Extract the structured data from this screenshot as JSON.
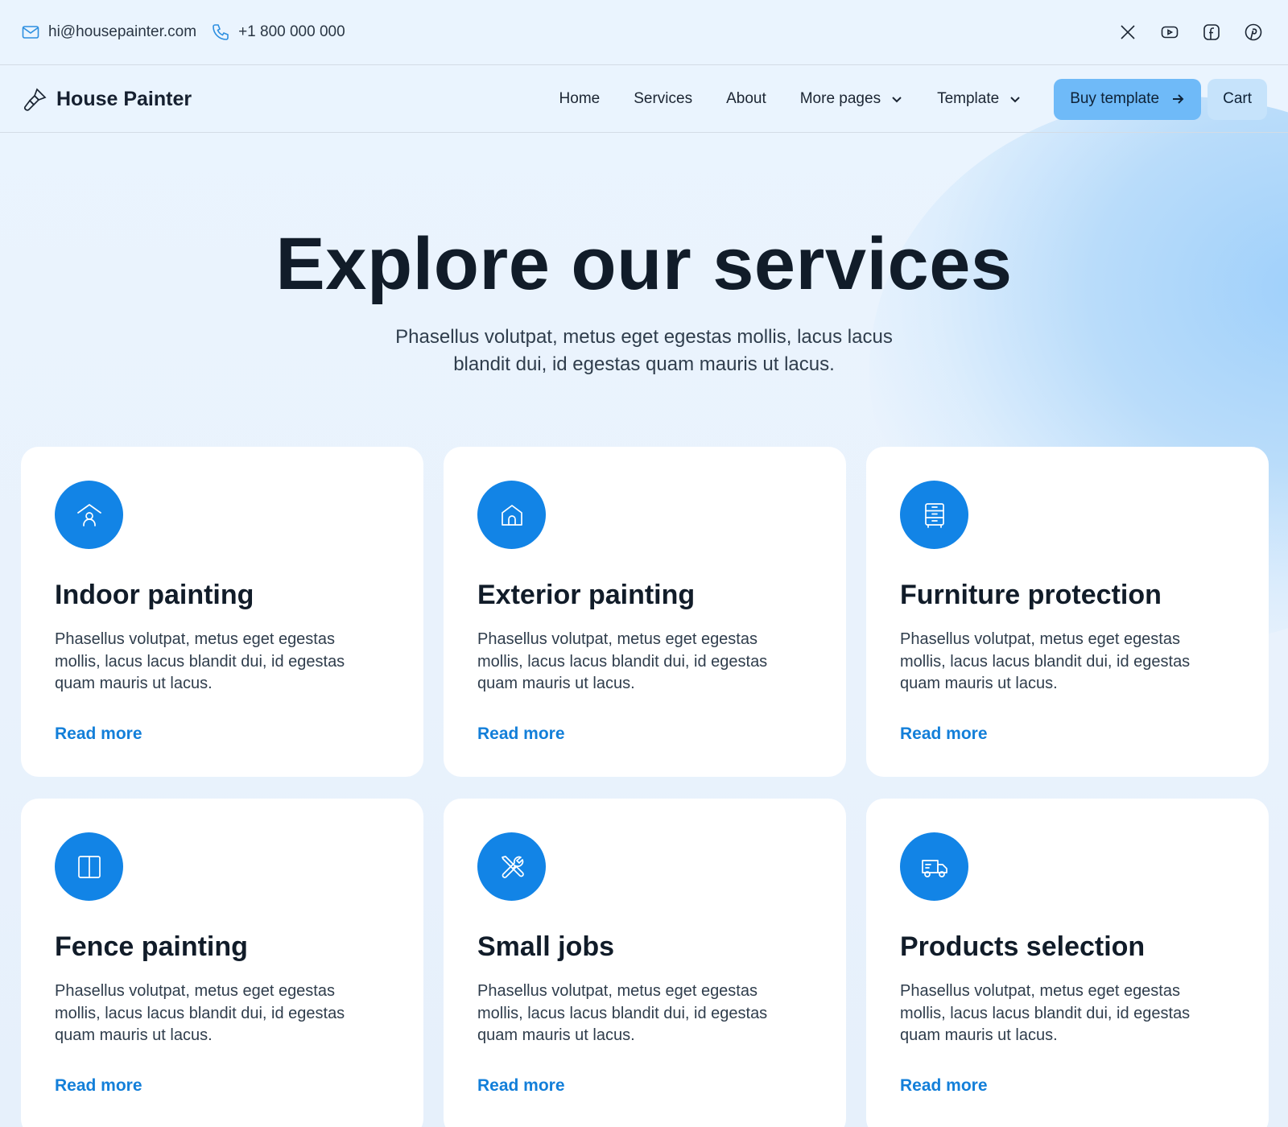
{
  "topbar": {
    "email": "hi@housepainter.com",
    "phone": "+1 800 000 000",
    "socials": [
      "x-icon",
      "youtube-icon",
      "facebook-icon",
      "pinterest-icon"
    ]
  },
  "navbar": {
    "brand": "House Painter",
    "links": [
      "Home",
      "Services",
      "About",
      "More pages",
      "Template"
    ],
    "buy_label": "Buy template",
    "cart_label": "Cart"
  },
  "hero": {
    "title": "Explore our services",
    "subtitle": "Phasellus volutpat, metus eget egestas mollis, lacus lacus blandit dui, id egestas quam mauris ut lacus."
  },
  "services": [
    {
      "icon": "house-person-icon",
      "title": "Indoor painting",
      "desc": "Phasellus volutpat, metus eget egestas mollis, lacus lacus blandit dui, id egestas quam mauris ut lacus.",
      "link": "Read more"
    },
    {
      "icon": "home-icon",
      "title": "Exterior painting",
      "desc": "Phasellus volutpat, metus eget egestas mollis, lacus lacus blandit dui, id egestas quam mauris ut lacus.",
      "link": "Read more"
    },
    {
      "icon": "cabinet-icon",
      "title": "Furniture protection",
      "desc": "Phasellus volutpat, metus eget egestas mollis, lacus lacus blandit dui, id egestas quam mauris ut lacus.",
      "link": "Read more"
    },
    {
      "icon": "panel-icon",
      "title": "Fence painting",
      "desc": "Phasellus volutpat, metus eget egestas mollis, lacus lacus blandit dui, id egestas quam mauris ut lacus.",
      "link": "Read more"
    },
    {
      "icon": "tools-icon",
      "title": "Small jobs",
      "desc": "Phasellus volutpat, metus eget egestas mollis, lacus lacus blandit dui, id egestas quam mauris ut lacus.",
      "link": "Read more"
    },
    {
      "icon": "truck-icon",
      "title": "Products selection",
      "desc": "Phasellus volutpat, metus eget egestas mollis, lacus lacus blandit dui, id egestas quam mauris ut lacus.",
      "link": "Read more"
    }
  ],
  "colors": {
    "accent": "#1284e6",
    "link": "#137fd9",
    "buy_button": "#6fbaf8",
    "cart_button": "#c6e3fb",
    "background": "#eaf4fe"
  }
}
